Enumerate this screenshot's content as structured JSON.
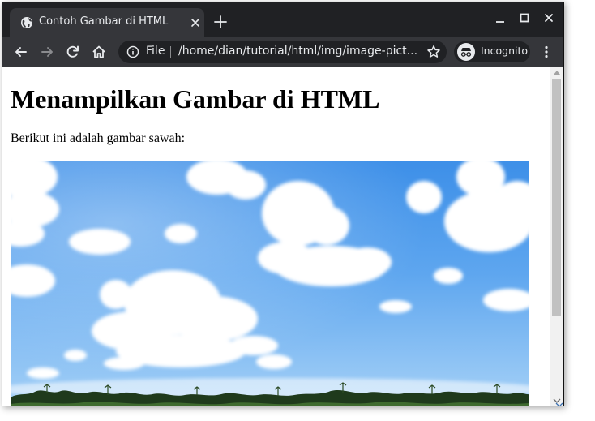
{
  "browser": {
    "tab": {
      "title": "Contoh Gambar di HTML",
      "favicon": "globe-icon",
      "close_icon": "close-icon"
    },
    "new_tab_icon": "plus-icon",
    "window_controls": [
      "minimize-icon",
      "maximize-icon",
      "close-icon"
    ],
    "toolbar": {
      "back_icon": "back-arrow-icon",
      "forward_icon": "forward-arrow-icon",
      "reload_icon": "reload-icon",
      "home_icon": "home-icon",
      "omnibox": {
        "info_icon": "info-icon",
        "scheme": "File",
        "url": "/home/dian/tutorial/html/img/image-pict...",
        "star_icon": "star-icon"
      },
      "profile_label": "Incognito",
      "profile_icon": "incognito-icon",
      "menu_icon": "more-vert-icon"
    },
    "colors": {
      "frame": "#202124",
      "toolbar": "#35363a",
      "text": "#e8eaed"
    }
  },
  "page": {
    "heading": "Menampilkan Gambar di HTML",
    "paragraph": "Berikut ini adalah gambar sawah:",
    "image": "sky-with-clouds-and-trees-photo"
  }
}
